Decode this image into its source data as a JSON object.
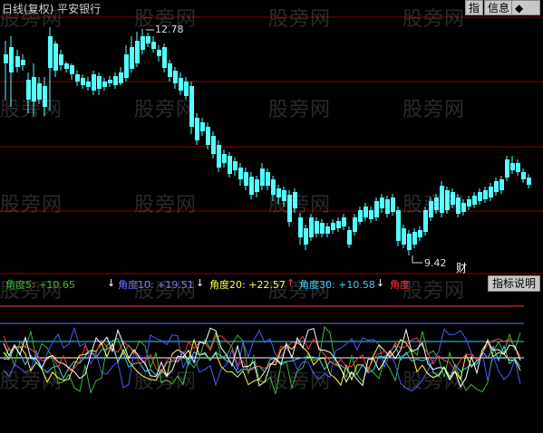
{
  "header": {
    "title": "日线(复权)  平安银行",
    "btn_indicator": "指",
    "btn_info": "信息",
    "btn_nav": "◆"
  },
  "watermark": "股旁网",
  "price_high_label": "12.78",
  "price_low_label": "9.42",
  "fin_marker": "财",
  "legend": {
    "a5": "角度5: +10.65",
    "a10": "角度10: +19.51",
    "a20": "角度20: +22.57",
    "a30": "角度30: +10.58",
    "a": "角度"
  },
  "indicator_button": "指标说明",
  "colors": {
    "up": "#ff3a3a",
    "down": "#54ffff",
    "grid": "#8b0000",
    "a5": "#ffffff",
    "a10": "#4a5cff",
    "a20": "#ffff40",
    "a30": "#3ad0ff",
    "a": "#ff3a3a",
    "green": "#3cba3c"
  }
}
